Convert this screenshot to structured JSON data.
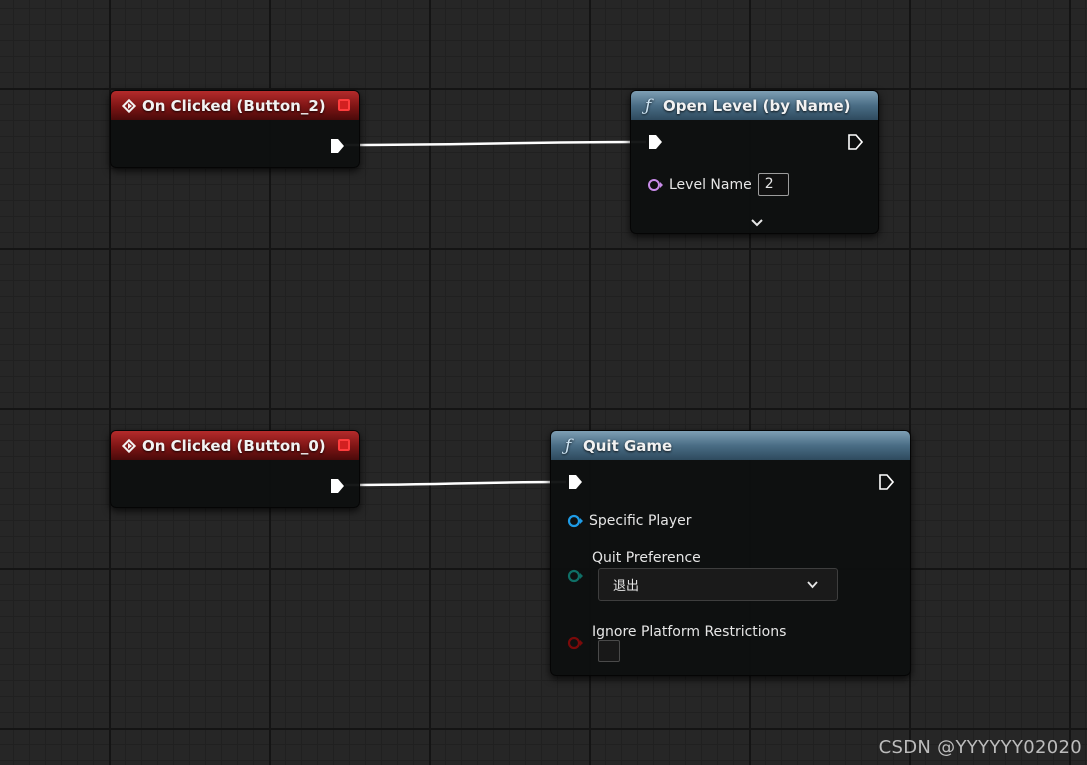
{
  "canvas": {
    "grid_color": "#262626",
    "wire_color": "#ffffff"
  },
  "nodes": {
    "on_clicked_2": {
      "title": "On Clicked (Button_2)",
      "header_color": "#8c1a1a",
      "icon": "event-diamond-icon"
    },
    "open_level": {
      "title": "Open Level (by Name)",
      "header_color": "#4a6d85",
      "icon": "function-icon",
      "pins": {
        "level_name_label": "Level Name",
        "level_name_value": "2"
      }
    },
    "on_clicked_0": {
      "title": "On Clicked (Button_0)",
      "header_color": "#8c1a1a",
      "icon": "event-diamond-icon"
    },
    "quit_game": {
      "title": "Quit Game",
      "header_color": "#4a6d85",
      "icon": "function-icon",
      "pins": {
        "specific_player_label": "Specific Player",
        "quit_preference_label": "Quit Preference",
        "quit_preference_value": "退出",
        "ignore_platform_label": "Ignore Platform Restrictions"
      }
    }
  },
  "watermark": "CSDN @YYYYYY02020"
}
